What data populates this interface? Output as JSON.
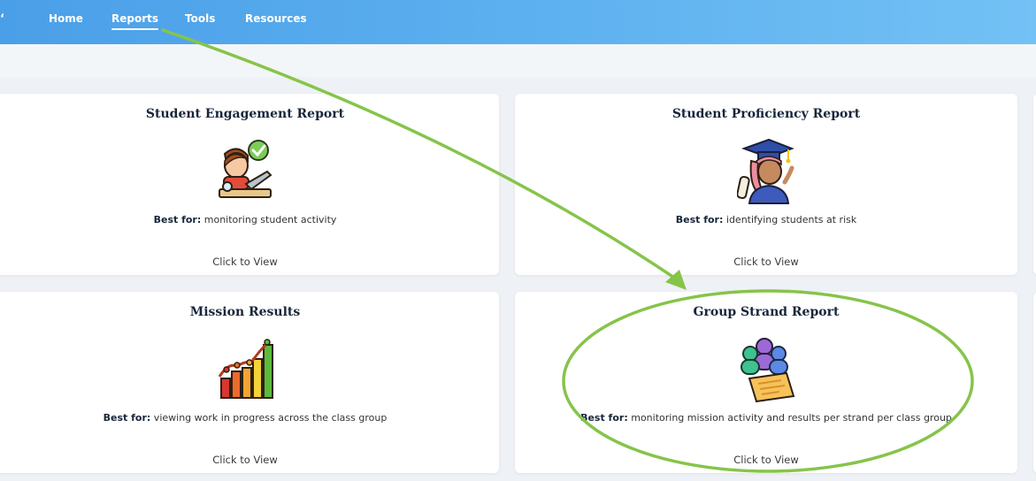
{
  "nav": {
    "logo_fragment": "ʻ",
    "items": [
      {
        "label": "Home"
      },
      {
        "label": "Reports",
        "active": true
      },
      {
        "label": "Tools"
      },
      {
        "label": "Resources"
      }
    ]
  },
  "cards": [
    {
      "title": "Student Engagement Report",
      "best_for_label": "Best for:",
      "best_for_text": " monitoring student activity",
      "cta": "Click to View",
      "icon": "student-laptop-icon"
    },
    {
      "title": "Student Proficiency Report",
      "best_for_label": "Best for:",
      "best_for_text": " identifying students at risk",
      "cta": "Click to View",
      "icon": "graduate-icon"
    },
    {
      "title": "Mission Results",
      "best_for_label": "Best for:",
      "best_for_text": " viewing work in progress across the class group",
      "cta": "Click to View",
      "icon": "bar-chart-icon"
    },
    {
      "title": "Group Strand Report",
      "best_for_label": "Best for:",
      "best_for_text": " monitoring mission activity and results per strand per class group",
      "cta": "Click to View",
      "icon": "group-report-icon"
    }
  ],
  "annotations": {
    "color": "#86c44a",
    "arrow_from": "Reports",
    "arrow_to": "Group Strand Report",
    "highlight": "Group Strand Report"
  },
  "colors": {
    "header_start": "#4a9fe8",
    "header_end": "#73c1f5",
    "background": "#eef1f5",
    "title_text": "#17263a"
  }
}
